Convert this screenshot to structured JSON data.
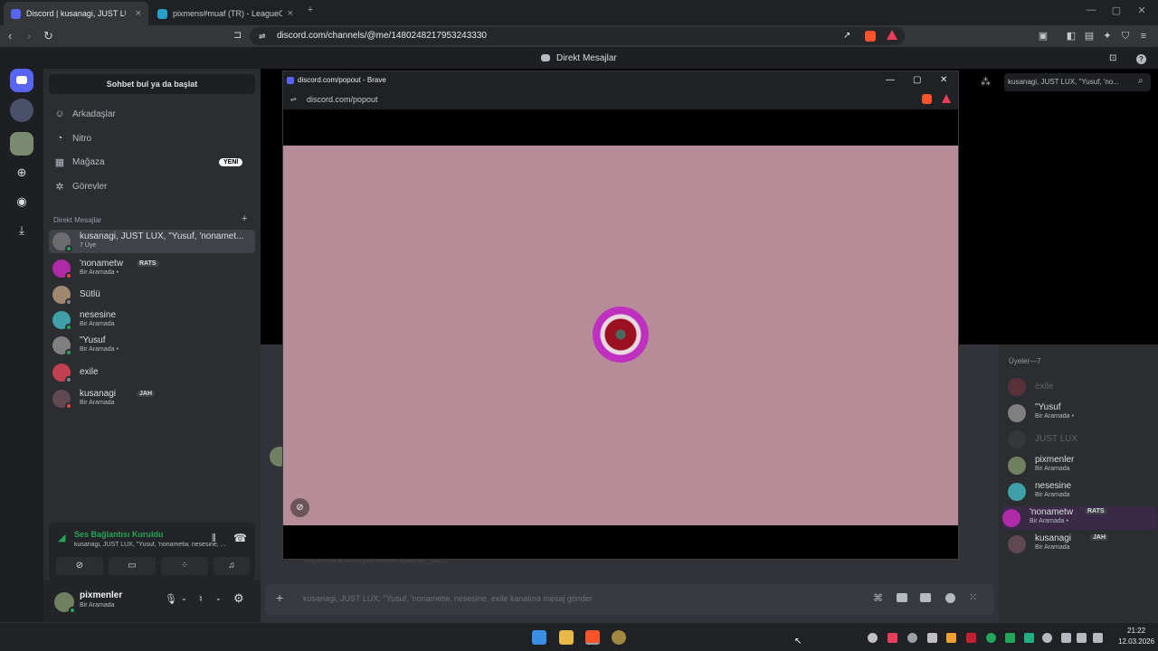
{
  "browser": {
    "tabs": [
      {
        "label": "Discord | kusanagi, JUST LUX..."
      },
      {
        "label": "pixmens#muaf (TR) - LeagueOfGraphs"
      }
    ],
    "new_tab": "+",
    "url": "discord.com/channels/@me/1480248217953243330"
  },
  "discord": {
    "title": "Direkt Mesajlar",
    "find_button": "Sohbet bul ya da başlat",
    "nav": [
      {
        "label": "Arkadaşlar",
        "icon": "friends-icon"
      },
      {
        "label": "Nitro",
        "icon": "nitro-icon"
      },
      {
        "label": "Mağaza",
        "icon": "shop-icon",
        "badge": "YENİ"
      },
      {
        "label": "Görevler",
        "icon": "quests-icon"
      }
    ],
    "dm_header": "Direkt Mesajlar",
    "dms": [
      {
        "name": "kusanagi, JUST LUX, \"Yusuf, 'nonamet...",
        "sub": "7 Üye",
        "color": "#6b6b70",
        "status": "#23a55a"
      },
      {
        "name": "'nonametw",
        "tag": "RATS",
        "sub": "Bir Aramada •",
        "color": "#b02aa8",
        "status": "#f23f43"
      },
      {
        "name": "Sütlü",
        "sub": "",
        "color": "#a08870",
        "status": "#80848e"
      },
      {
        "name": "nesesine",
        "sub": "Bir Aramada",
        "color": "#40a0a8",
        "status": "#23a55a"
      },
      {
        "name": "\"Yusuf",
        "sub": "Bir Aramada •",
        "color": "#808080",
        "status": "#23a55a"
      },
      {
        "name": "exile",
        "sub": "",
        "color": "#c04050",
        "status": "#80848e"
      },
      {
        "name": "kusanagi",
        "tag": "JAH",
        "sub": "Bir Aramada",
        "color": "#604850",
        "status": "#f23f43"
      }
    ],
    "voice": {
      "status": "Ses Bağlantısı Kuruldu",
      "channel": "kusanagi, JUST LUX, \"Yusuf, 'nonametw, nesesine, ..."
    },
    "user": {
      "name": "pixmenler",
      "status": "Bir Aramada"
    },
    "search_placeholder": "kusanagi, JUST LUX, \"Yusuf, 'no...",
    "members_header": "Üyeler—7",
    "members": [
      {
        "name": "exile",
        "sub": "",
        "color": "#c04050",
        "dim": true
      },
      {
        "name": "\"Yusuf",
        "sub": "Bir Aramada •",
        "color": "#808080",
        "dim": false
      },
      {
        "name": "JUST LUX",
        "sub": "",
        "color": "#505055",
        "dim": true
      },
      {
        "name": "pixmenler",
        "sub": "Bir Aramada",
        "color": "#708060",
        "dim": false
      },
      {
        "name": "nesesine",
        "sub": "Bir Aramada",
        "color": "#40a0a8",
        "dim": false
      },
      {
        "name": "'nonametw",
        "tag": "RATS",
        "sub": "Bir Aramada •",
        "color": "#b02aa8",
        "dim": false
      },
      {
        "name": "kusanagi",
        "tag": "JAH",
        "sub": "Bir Aramada",
        "color": "#604850",
        "dim": false
      }
    ],
    "composer_placeholder": "kusanagi, JUST LUX, \"Yusuf, 'nonametw, nesesine, exile kanalına mesaj gönder",
    "link_text": "https://lock.com/pixmens/clips/clip_01..."
  },
  "popout": {
    "title": "discord.com/popout - Brave",
    "url": "discord.com/popout"
  },
  "taskbar": {
    "time": "21:22",
    "date": "12.03.2026"
  }
}
